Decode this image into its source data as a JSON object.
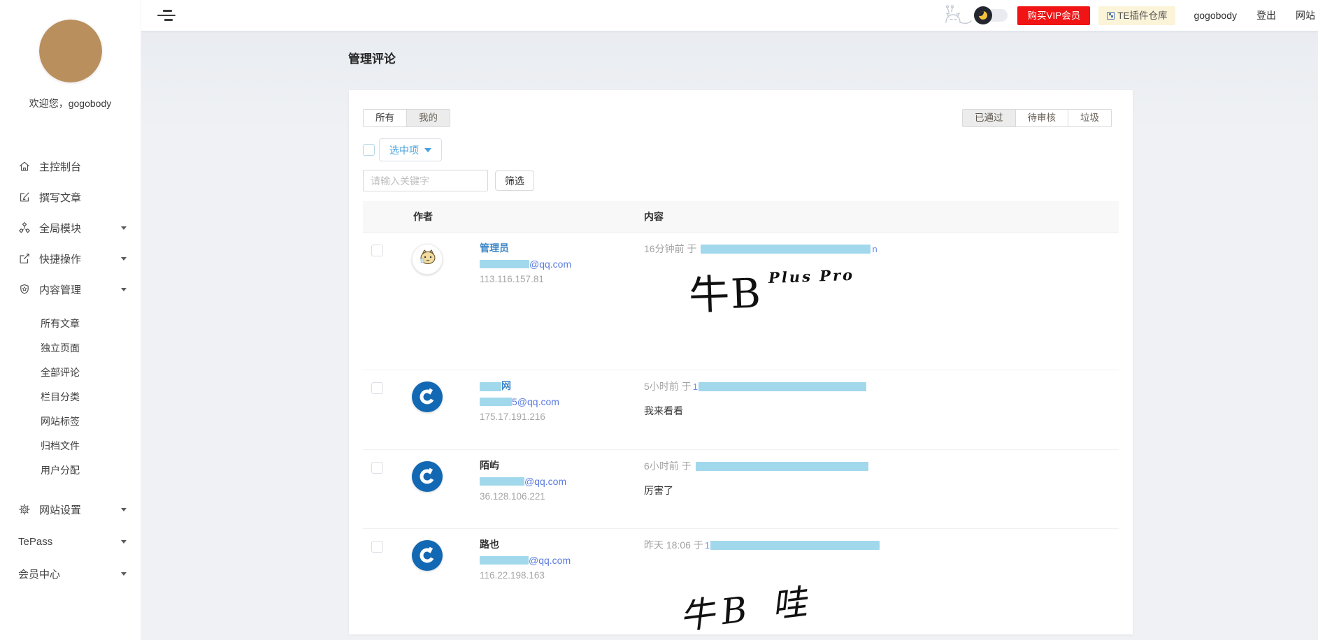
{
  "topbar": {
    "buy_vip_label": "购买VIP会员",
    "plugin_store_label": "TE插件仓库",
    "username": "gogobody",
    "logout_label": "登出",
    "site_label": "网站"
  },
  "sidebar": {
    "welcome": "欢迎您，gogobody",
    "menu": [
      {
        "label": "主控制台",
        "icon": "home-icon",
        "expandable": false
      },
      {
        "label": "撰写文章",
        "icon": "edit-icon",
        "expandable": false
      },
      {
        "label": "全局模块",
        "icon": "modules-icon",
        "expandable": true
      },
      {
        "label": "快捷操作",
        "icon": "external-link-icon",
        "expandable": true
      },
      {
        "label": "内容管理",
        "icon": "badge-icon",
        "expandable": true
      }
    ],
    "content_submenu": [
      {
        "label": "所有文章"
      },
      {
        "label": "独立页面"
      },
      {
        "label": "全部评论"
      },
      {
        "label": "栏目分类"
      },
      {
        "label": "网站标签"
      },
      {
        "label": "归档文件"
      },
      {
        "label": "用户分配"
      }
    ],
    "bottom_menu": [
      {
        "label": "网站设置",
        "icon": "gear-icon",
        "expandable": true
      },
      {
        "label": "TePass",
        "icon": "none",
        "expandable": true
      },
      {
        "label": "会员中心",
        "icon": "none",
        "expandable": true
      }
    ]
  },
  "page": {
    "title": "管理评论"
  },
  "toolbar": {
    "scope_tabs": [
      {
        "label": "所有",
        "active": true
      },
      {
        "label": "我的",
        "active": false
      }
    ],
    "status_tabs": [
      {
        "label": "已通过",
        "active": true
      },
      {
        "label": "待审核",
        "active": false
      },
      {
        "label": "垃圾",
        "active": false
      }
    ],
    "bulk_dropdown_label": "选中项",
    "search_placeholder": "请输入关键字",
    "filter_button_label": "筛选"
  },
  "table": {
    "columns": {
      "author": "作者",
      "content": "内容"
    },
    "rows": [
      {
        "avatar": "cat-meme-avatar",
        "name": "管理员",
        "name_is_link": true,
        "email_redacted": true,
        "email_visible": "@qq.com",
        "ip": "113.116.157.81",
        "time": "16分钟前 于",
        "link_redacted": true,
        "link_tail": "n",
        "comment_kind": "handwriting-image",
        "handwriting_main": "牛B",
        "handwriting_sup": "Plus Pro"
      },
      {
        "avatar": "blue-power-avatar",
        "name": "网",
        "name_redacted_prefix": true,
        "name_is_link": true,
        "email_redacted": true,
        "email_visible": "5@qq.com",
        "ip": "175.17.191.216",
        "time": "5小时前 于",
        "link_head": "1",
        "link_redacted": true,
        "comment_kind": "text",
        "comment": "我来看看"
      },
      {
        "avatar": "blue-power-avatar",
        "name": "陌屿",
        "name_is_link": false,
        "email_redacted": true,
        "email_visible": "@qq.com",
        "ip": "36.128.106.221",
        "time": "6小时前 于",
        "link_redacted": true,
        "comment_kind": "text",
        "comment": "厉害了"
      },
      {
        "avatar": "blue-power-avatar",
        "name": "路也",
        "name_is_link": false,
        "email_redacted": true,
        "email_visible": "@qq.com",
        "ip": "116.22.198.163",
        "time": "昨天 18:06 于",
        "link_head": "1",
        "link_redacted": true,
        "comment_kind": "handwriting-image",
        "handwriting_main": "牛B 哇"
      }
    ]
  },
  "colors": {
    "vip_button_red": "#f01414",
    "plugin_button_yellow": "#fcf4d9",
    "name_link_blue": "#3e86c6",
    "email_link_blue": "#5b7be0",
    "redaction_blue": "#a2d8ec",
    "dropdown_blue": "#46a0dc",
    "main_background": "#eff1f4"
  }
}
